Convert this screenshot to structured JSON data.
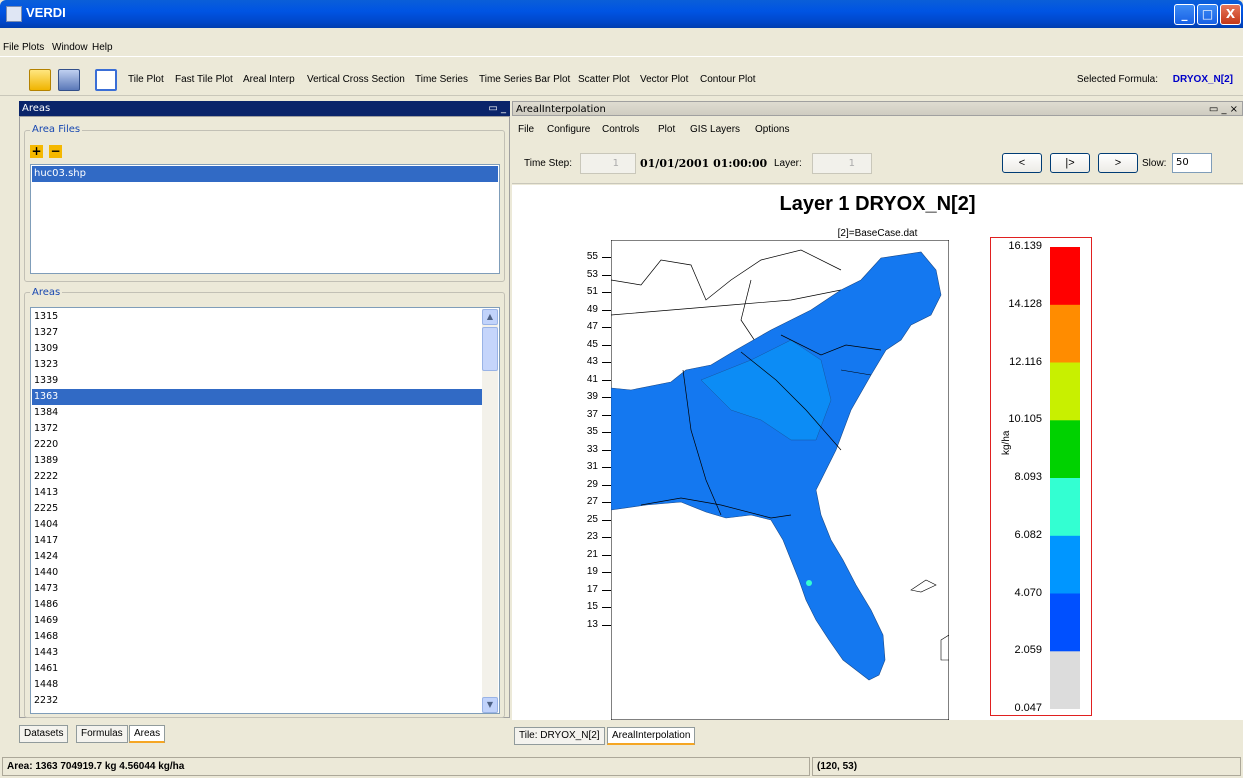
{
  "window": {
    "title": "VERDI",
    "minimize": "_",
    "maximize": "□",
    "close": "X"
  },
  "menubar": {
    "items": [
      "File",
      "Plots",
      "Window",
      "Help"
    ]
  },
  "toolbar": {
    "buttons": [
      "Tile Plot",
      "Fast Tile Plot",
      "Areal Interp",
      "Vertical Cross Section",
      "Time Series",
      "Time Series Bar Plot",
      "Scatter Plot",
      "Vector Plot",
      "Contour Plot"
    ],
    "selected_formula_label": "Selected Formula:",
    "selected_formula": "DRYOX_N[2]"
  },
  "left_panel": {
    "title": "Areas",
    "area_files": {
      "title": "Area Files",
      "add": "+",
      "remove": "−",
      "files": [
        "huc03.shp"
      ]
    },
    "areas": {
      "title": "Areas",
      "items": [
        "1315",
        "1327",
        "1309",
        "1323",
        "1339",
        "1363",
        "1384",
        "1372",
        "2220",
        "1389",
        "2222",
        "1413",
        "2225",
        "1404",
        "1417",
        "1424",
        "1440",
        "1473",
        "1486",
        "1469",
        "1468",
        "1443",
        "1461",
        "1448",
        "2232"
      ],
      "selected": "1363"
    },
    "tabs": [
      "Datasets",
      "Formulas",
      "Areas"
    ]
  },
  "right_panel": {
    "title": "ArealInterpolation",
    "menu": [
      "File",
      "Configure",
      "Controls",
      "Plot",
      "GIS Layers",
      "Options"
    ],
    "controls": {
      "time_step_label": "Time Step:",
      "time_step_value": "1",
      "timestamp": "01/01/2001 01:00:00",
      "layer_label": "Layer:",
      "layer_value": "1",
      "nav_buttons": [
        "<",
        "|>",
        ">"
      ],
      "slow_label": "Slow:",
      "slow_value": "50"
    },
    "tabs": [
      "Tile: DRYOX_N[2]",
      "ArealInterpolation"
    ]
  },
  "chart_data": {
    "type": "heatmap",
    "title": "Layer 1 DRYOX_N[2]",
    "subtitle": "[2]=BaseCase.dat",
    "y_ticks": [
      "55",
      "53",
      "51",
      "49",
      "47",
      "45",
      "43",
      "41",
      "39",
      "37",
      "35",
      "33",
      "31",
      "29",
      "27",
      "25",
      "23",
      "21",
      "19",
      "17",
      "15",
      "13"
    ],
    "legend": {
      "unit": "kg/ha",
      "ticks": [
        "16.139",
        "14.128",
        "12.116",
        "10.105",
        "8.093",
        "6.082",
        "4.070",
        "2.059",
        "0.047"
      ],
      "colors": [
        "#ff0000",
        "#ff8c00",
        "#c8f000",
        "#00d200",
        "#33ffd2",
        "#0096ff",
        "#0050ff",
        "#dcdcdc"
      ]
    }
  },
  "status": {
    "left": "Area: 1363 704919.7 kg 4.56044 kg/ha",
    "right": "(120, 53)"
  }
}
